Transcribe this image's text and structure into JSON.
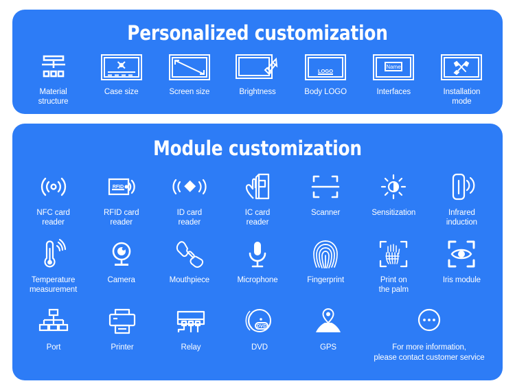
{
  "theme": {
    "page_background": "#ffffff",
    "panel_background": "#2d7cf6",
    "text_color": "#ffffff",
    "icon_color": "#ffffff"
  },
  "panels": [
    {
      "title": "Personalized customization",
      "items": [
        {
          "label": "Material\nstructure",
          "icon": "material-structure-icon"
        },
        {
          "label": "Case size",
          "icon": "case-size-icon"
        },
        {
          "label": "Screen size",
          "icon": "screen-size-icon"
        },
        {
          "label": "Brightness",
          "icon": "brightness-icon"
        },
        {
          "label": "Body LOGO",
          "icon": "body-logo-icon",
          "icon_text": "LOGO"
        },
        {
          "label": "Interfaces",
          "icon": "interfaces-icon",
          "icon_text": "Name"
        },
        {
          "label": "Installation\nmode",
          "icon": "installation-mode-icon"
        }
      ]
    },
    {
      "title": "Module customization",
      "rows": [
        [
          {
            "label": "NFC card\nreader",
            "icon": "nfc-card-reader-icon"
          },
          {
            "label": "RFID card\nreader",
            "icon": "rfid-card-reader-icon",
            "icon_text": "RFID"
          },
          {
            "label": "ID card\nreader",
            "icon": "id-card-reader-icon"
          },
          {
            "label": "IC card\nreader",
            "icon": "ic-card-reader-icon"
          },
          {
            "label": "Scanner",
            "icon": "scanner-icon"
          },
          {
            "label": "Sensitization",
            "icon": "sensitization-icon"
          },
          {
            "label": "Infrared\ninduction",
            "icon": "infrared-induction-icon"
          }
        ],
        [
          {
            "label": "Temperature\nmeasurement",
            "icon": "temperature-measurement-icon"
          },
          {
            "label": "Camera",
            "icon": "camera-icon"
          },
          {
            "label": "Mouthpiece",
            "icon": "mouthpiece-icon"
          },
          {
            "label": "Microphone",
            "icon": "microphone-icon"
          },
          {
            "label": "Fingerprint",
            "icon": "fingerprint-icon"
          },
          {
            "label": "Print on\nthe palm",
            "icon": "palm-print-icon"
          },
          {
            "label": "Iris module",
            "icon": "iris-module-icon"
          }
        ],
        [
          {
            "label": "Port",
            "icon": "port-icon"
          },
          {
            "label": "Printer",
            "icon": "printer-icon"
          },
          {
            "label": "Relay",
            "icon": "relay-icon"
          },
          {
            "label": "DVD",
            "icon": "dvd-icon",
            "icon_text": "DVD"
          },
          {
            "label": "GPS",
            "icon": "gps-icon"
          },
          {
            "label": "For more information,\nplease contact customer service",
            "icon": "more-info-icon"
          }
        ]
      ]
    }
  ]
}
